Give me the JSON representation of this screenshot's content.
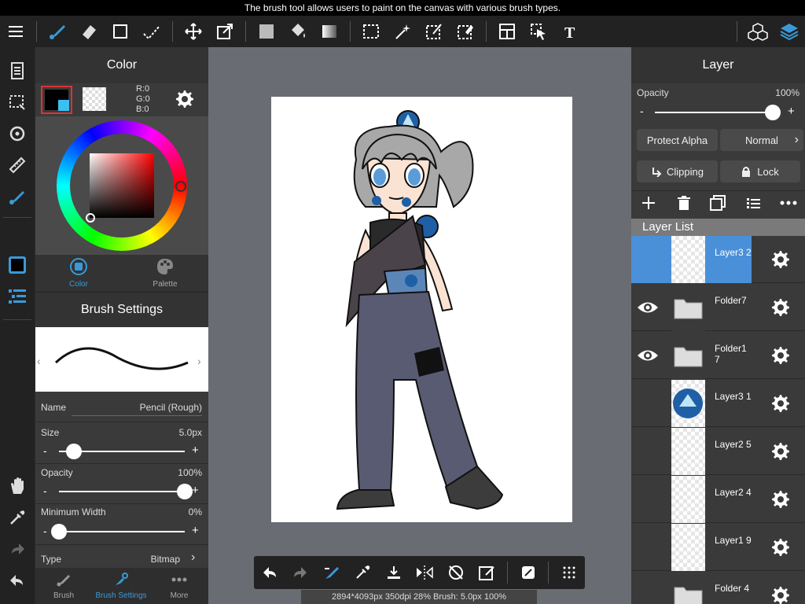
{
  "tooltip": "The brush tool allows users to paint on the canvas with various brush types.",
  "color_panel": {
    "title": "Color",
    "rgb": {
      "r": "R:0",
      "g": "G:0",
      "b": "B:0"
    },
    "tabs": [
      {
        "label": "Color"
      },
      {
        "label": "Palette"
      }
    ],
    "primary_color": "#000000",
    "accent_color": "#3a9ad9"
  },
  "brush_panel": {
    "title": "Brush Settings",
    "name_label": "Name",
    "name_value": "Pencil (Rough)",
    "size_label": "Size",
    "size_value": "5.0px",
    "size_fraction": 0.12,
    "opacity_label": "Opacity",
    "opacity_value": "100%",
    "opacity_fraction": 1.0,
    "minwidth_label": "Minimum Width",
    "minwidth_value": "0%",
    "minwidth_fraction": 0.0,
    "type_label": "Type",
    "type_value": "Bitmap",
    "bottom_tabs": [
      {
        "label": "Brush"
      },
      {
        "label": "Brush Settings"
      },
      {
        "label": "More"
      }
    ]
  },
  "layer_panel": {
    "title": "Layer",
    "opacity_label": "Opacity",
    "opacity_value": "100%",
    "protect_alpha": "Protect Alpha",
    "blend_mode": "Normal",
    "clipping": "Clipping",
    "lock": "Lock",
    "list_title": "Layer List",
    "layers": [
      {
        "name": "Layer3 2",
        "visible": false,
        "selected": true,
        "kind": "layer"
      },
      {
        "name": "Folder7",
        "visible": true,
        "selected": false,
        "kind": "folder"
      },
      {
        "name": "Folder1 7",
        "visible": true,
        "selected": false,
        "kind": "folder"
      },
      {
        "name": "Layer3 1",
        "visible": false,
        "selected": false,
        "kind": "layer"
      },
      {
        "name": "Layer2 5",
        "visible": false,
        "selected": false,
        "kind": "layer"
      },
      {
        "name": "Layer2 4",
        "visible": false,
        "selected": false,
        "kind": "layer"
      },
      {
        "name": "Layer1 9",
        "visible": false,
        "selected": false,
        "kind": "layer"
      },
      {
        "name": "Folder 4",
        "visible": false,
        "selected": false,
        "kind": "folder"
      }
    ]
  },
  "status": "2894*4093px 350dpi 28% Brush: 5.0px 100%"
}
